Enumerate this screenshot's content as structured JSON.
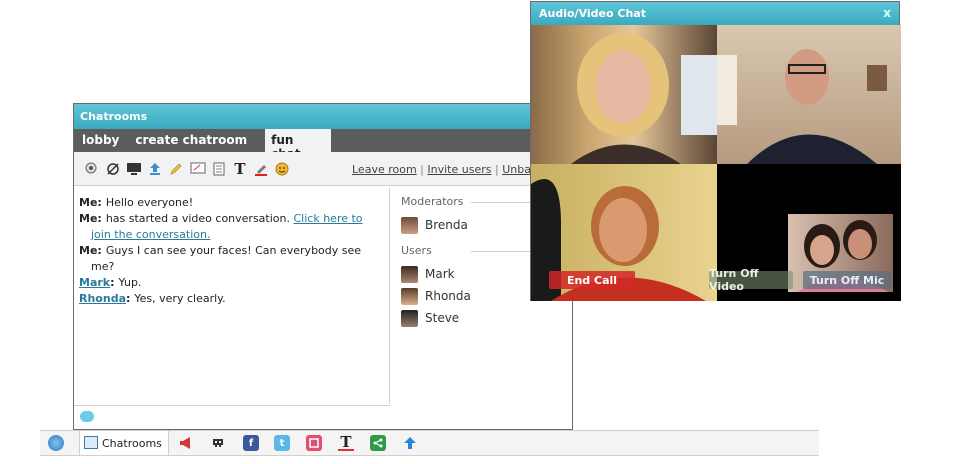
{
  "chatrooms": {
    "title": "Chatrooms",
    "tabs": [
      "lobby",
      "create chatroom",
      "fun chat"
    ],
    "toolbar_links": {
      "leave": "Leave room",
      "invite": "Invite users",
      "unban": "Unban"
    },
    "messages": [
      {
        "from": "Me:",
        "text": "Hello everyone!"
      },
      {
        "from": "Me:",
        "text": "has started a video conversation.",
        "link": "Click here to",
        "link2": "join the conversation."
      },
      {
        "from": "Me:",
        "text": "Guys I can see your faces! Can everybody see",
        "cont": "me?"
      },
      {
        "from": "Mark",
        "text": "Yup."
      },
      {
        "from": "Rhonda",
        "text": "Yes, very clearly."
      }
    ],
    "moderators_label": "Moderators",
    "moderators": [
      "Brenda"
    ],
    "users_label": "Users",
    "users": [
      "Mark",
      "Rhonda",
      "Steve"
    ]
  },
  "video": {
    "title": "Audio/Video Chat",
    "close": "x",
    "buttons": {
      "end_call": "End Call",
      "turn_off_video": "Turn Off Video",
      "turn_off_mic": "Turn Off Mic"
    }
  },
  "taskbar": {
    "chatrooms_label": "Chatrooms"
  },
  "colors": {
    "accent": "#3aa9c0",
    "tab_bar": "#5c5c5c",
    "link": "#2a7a9c"
  }
}
